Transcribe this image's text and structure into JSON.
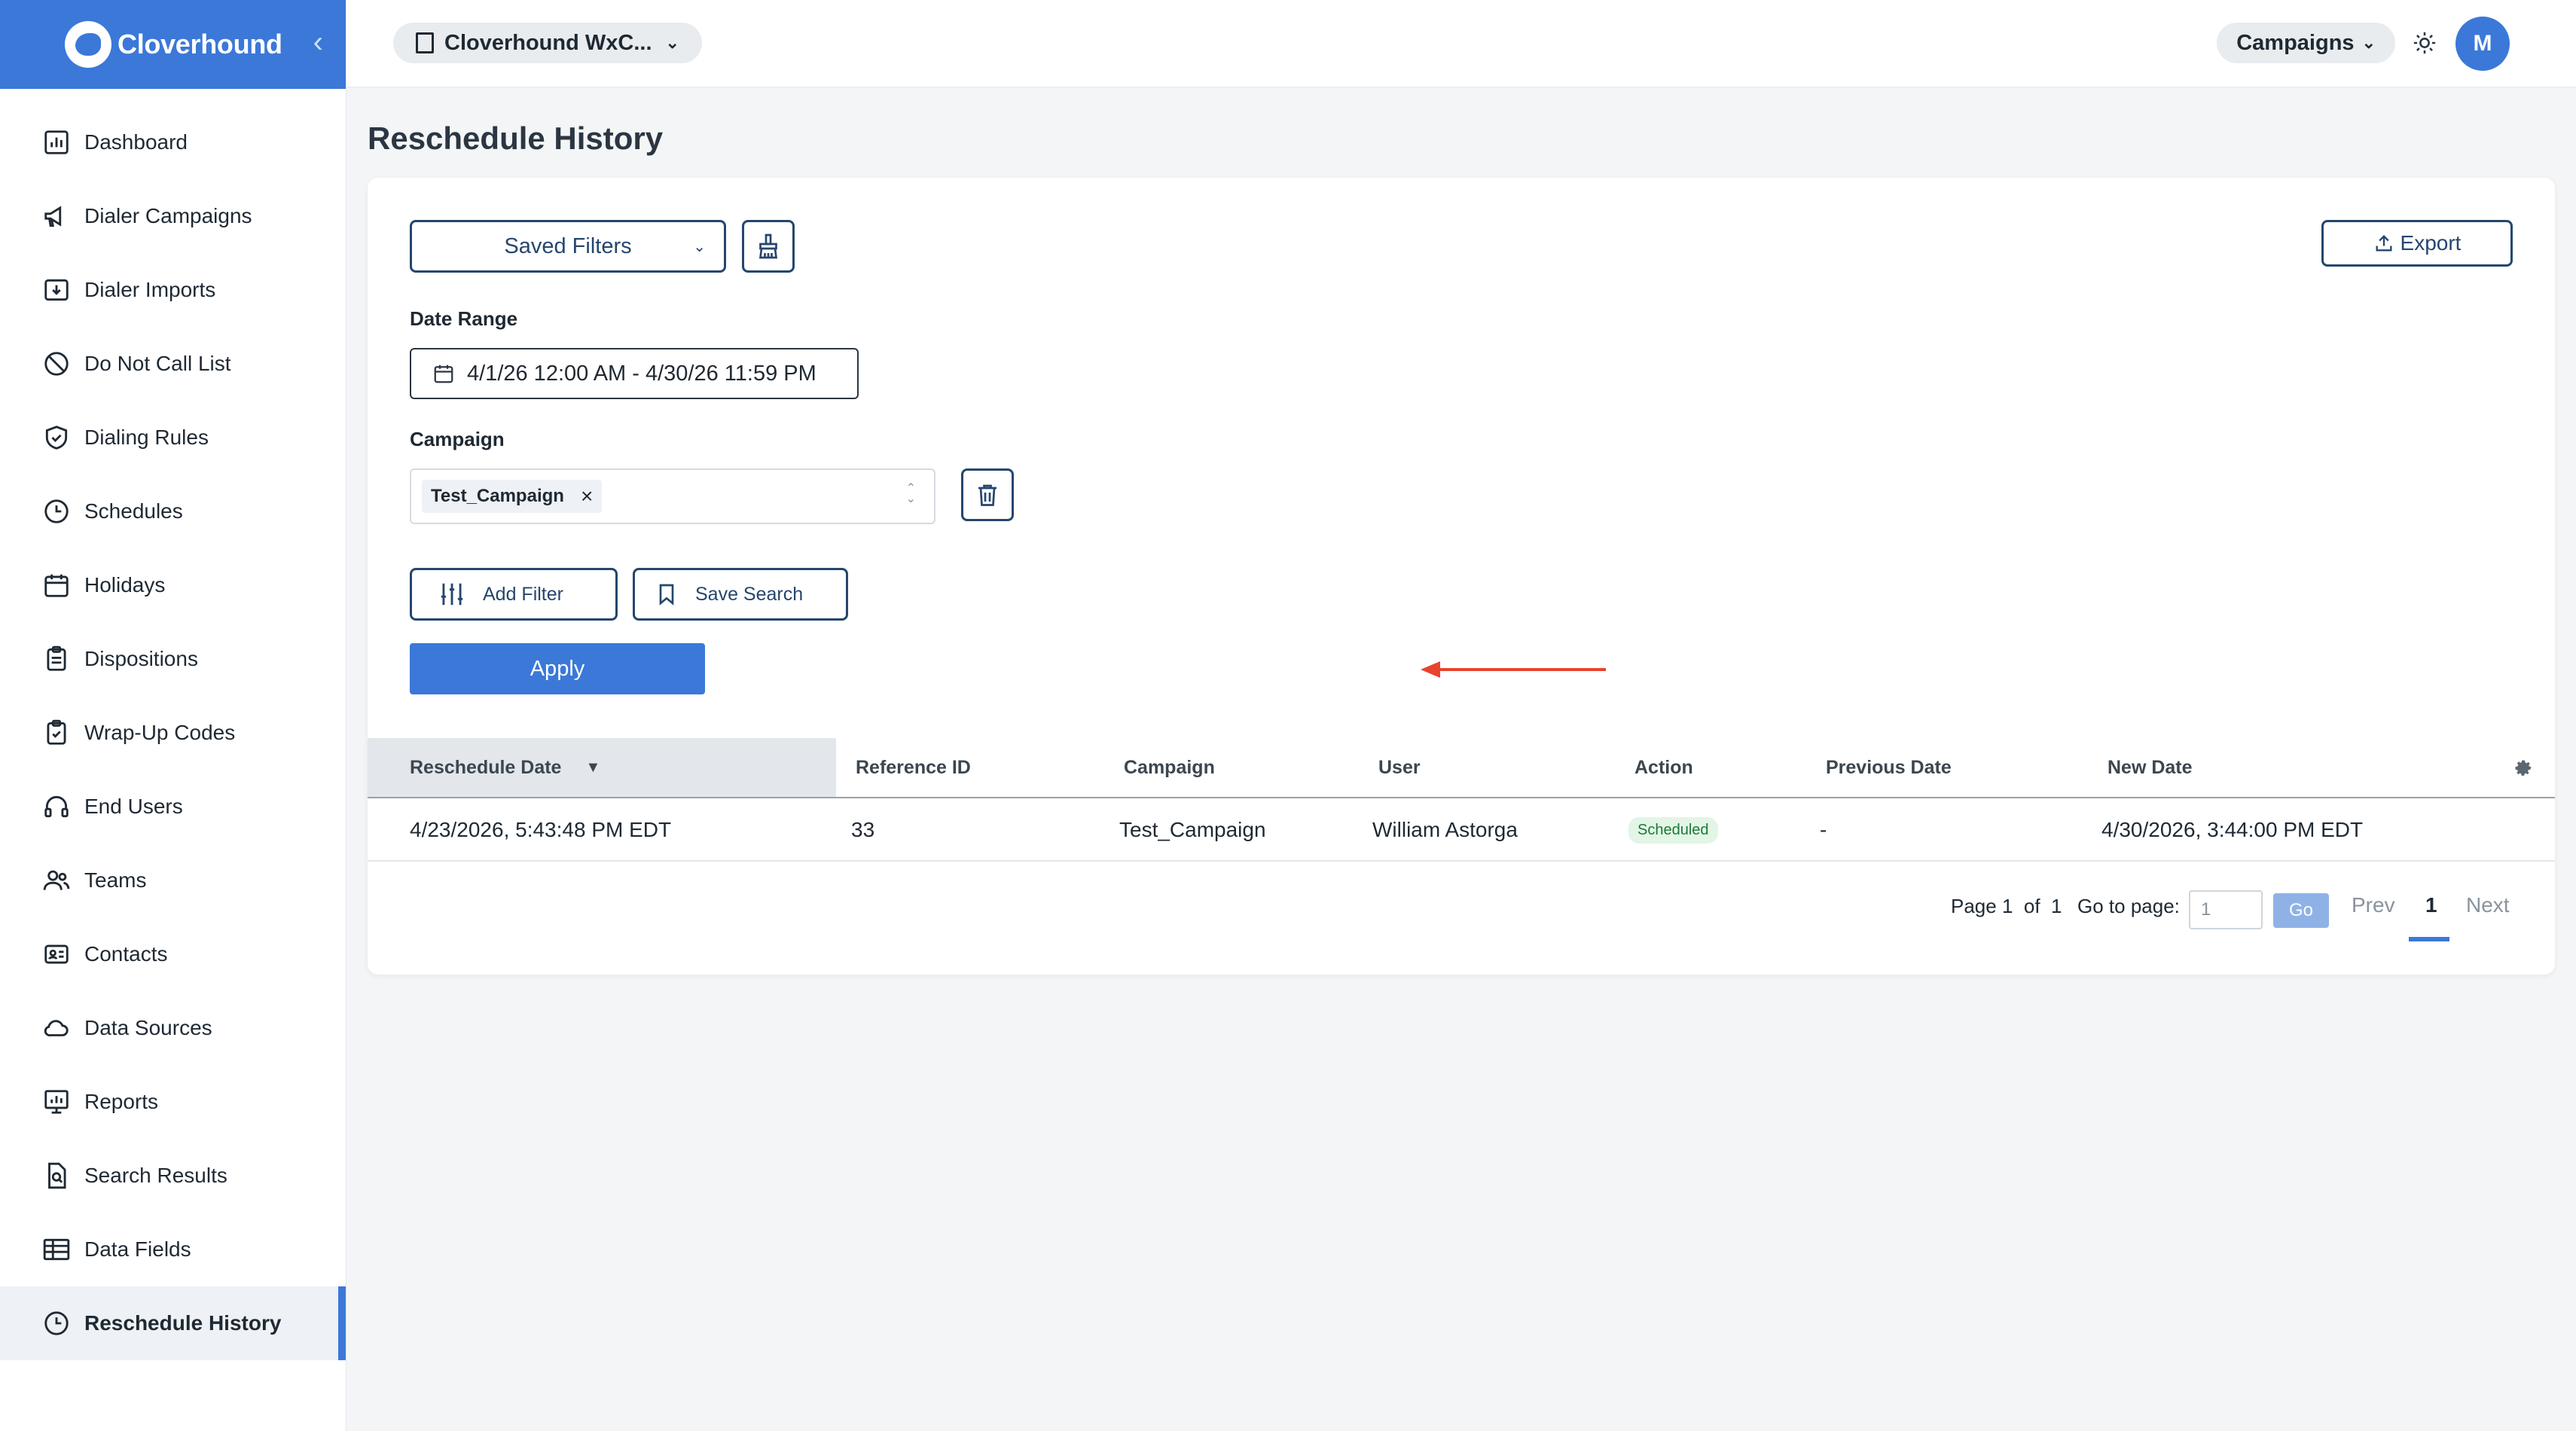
{
  "brand": {
    "name": "Cloverhound",
    "collapse_glyph": "‹"
  },
  "sidebar": {
    "items": [
      {
        "label": "Dashboard",
        "icon": "dashboard-icon"
      },
      {
        "label": "Dialer Campaigns",
        "icon": "megaphone-icon"
      },
      {
        "label": "Dialer Imports",
        "icon": "import-icon"
      },
      {
        "label": "Do Not Call List",
        "icon": "block-icon"
      },
      {
        "label": "Dialing Rules",
        "icon": "shield-icon"
      },
      {
        "label": "Schedules",
        "icon": "clock-icon"
      },
      {
        "label": "Holidays",
        "icon": "calendar-icon"
      },
      {
        "label": "Dispositions",
        "icon": "clipboard-icon"
      },
      {
        "label": "Wrap-Up Codes",
        "icon": "clipboard-check-icon"
      },
      {
        "label": "End Users",
        "icon": "headset-icon"
      },
      {
        "label": "Teams",
        "icon": "users-icon"
      },
      {
        "label": "Contacts",
        "icon": "contact-card-icon"
      },
      {
        "label": "Data Sources",
        "icon": "cloud-icon"
      },
      {
        "label": "Reports",
        "icon": "report-icon"
      },
      {
        "label": "Search Results",
        "icon": "file-search-icon"
      },
      {
        "label": "Data Fields",
        "icon": "table-icon"
      },
      {
        "label": "Reschedule History",
        "icon": "clock-icon",
        "active": true
      }
    ]
  },
  "topbar": {
    "org_label": "Cloverhound WxC...",
    "app_label": "Campaigns",
    "avatar_initial": "M"
  },
  "page": {
    "title": "Reschedule History"
  },
  "filters": {
    "saved_filters_label": "Saved Filters",
    "export_label": "Export",
    "date_range_label": "Date Range",
    "date_range_value": "4/1/26 12:00 AM - 4/30/26 11:59 PM",
    "campaign_label": "Campaign",
    "campaign_tag": "Test_Campaign",
    "remove_glyph": "×",
    "add_filter_label": "Add Filter",
    "save_search_label": "Save Search",
    "apply_label": "Apply"
  },
  "table": {
    "columns": [
      "Reschedule Date",
      "Reference ID",
      "Campaign",
      "User",
      "Action",
      "Previous Date",
      "New Date"
    ],
    "sort_glyph": "▼",
    "rows": [
      {
        "reschedule_date": "4/23/2026, 5:43:48 PM EDT",
        "reference_id": "33",
        "campaign": "Test_Campaign",
        "user": "William Astorga",
        "action": "Scheduled",
        "previous_date": "-",
        "new_date": "4/30/2026, 3:44:00 PM EDT"
      }
    ]
  },
  "pagination": {
    "page_word": "Page",
    "current": "1",
    "of_word": "of",
    "total": "1",
    "go_to_label": "Go to page:",
    "input_placeholder": "1",
    "go_label": "Go",
    "prev_label": "Prev",
    "next_label": "Next"
  },
  "colors": {
    "accent": "#3b78d8",
    "outline": "#25466e",
    "annotation_arrow": "#e8432d"
  }
}
